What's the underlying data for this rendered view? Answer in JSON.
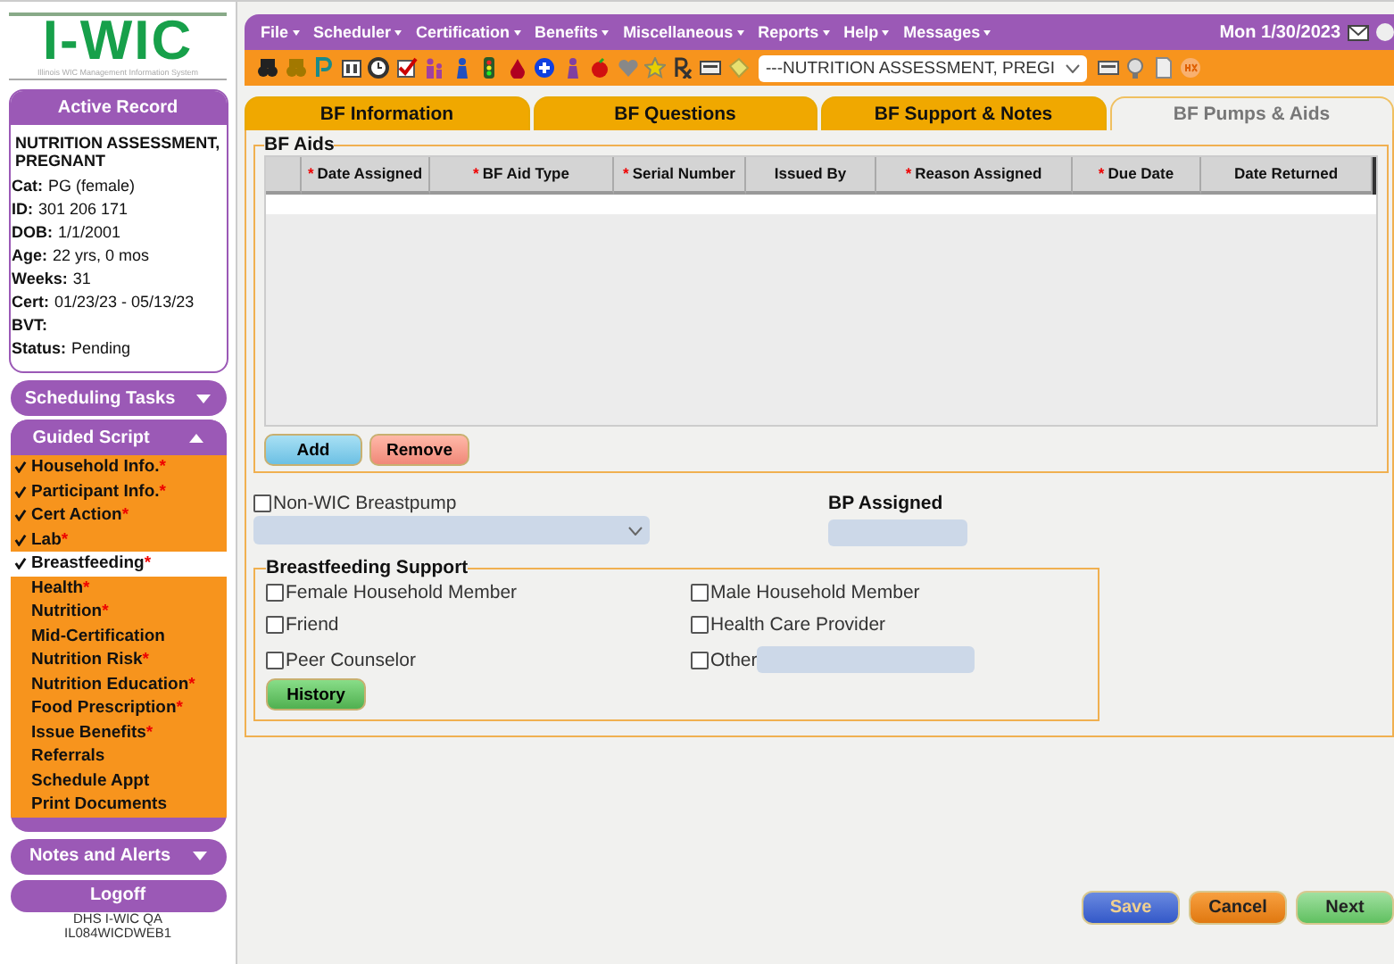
{
  "logo": {
    "title": "I-WIC",
    "subtitle": "Illinois WIC Management Information System"
  },
  "menu": [
    {
      "label": "File"
    },
    {
      "label": "Scheduler"
    },
    {
      "label": "Certification"
    },
    {
      "label": "Benefits"
    },
    {
      "label": "Miscellaneous"
    },
    {
      "label": "Reports"
    },
    {
      "label": "Help"
    },
    {
      "label": "Messages"
    }
  ],
  "date": "Mon 1/30/2023",
  "toolbar": {
    "record_select": "---NUTRITION ASSESSMENT, PREGI"
  },
  "active_record": {
    "title": "Active Record",
    "name": "NUTRITION ASSESSMENT, PREGNANT",
    "fields": [
      {
        "label": "Cat:",
        "value": "PG (female)"
      },
      {
        "label": "ID:",
        "value": "301 206 171"
      },
      {
        "label": "DOB:",
        "value": "1/1/2001"
      },
      {
        "label": "Age:",
        "value": "22 yrs, 0 mos"
      },
      {
        "label": "Weeks:",
        "value": "31"
      },
      {
        "label": "Cert:",
        "value": "01/23/23 - 05/13/23"
      },
      {
        "label": "BVT:"
      },
      {
        "label": "Status:",
        "value": "Pending"
      }
    ]
  },
  "scheduling_tasks": {
    "label": "Scheduling Tasks",
    "expanded": false
  },
  "guided_script": {
    "label": "Guided Script",
    "expanded": true,
    "items": [
      {
        "label": "Household Info.",
        "mark": "*",
        "checked": true,
        "selected": false
      },
      {
        "label": "Participant Info.",
        "mark": "*",
        "checked": true,
        "selected": false
      },
      {
        "label": "Cert Action",
        "mark": "*",
        "checked": true,
        "selected": false
      },
      {
        "label": "Lab",
        "mark": "*",
        "checked": true,
        "selected": false
      },
      {
        "label": "Breastfeeding",
        "mark": "*",
        "checked": true,
        "selected": true
      },
      {
        "label": "Health",
        "mark": "*",
        "checked": false,
        "selected": false
      },
      {
        "label": "Nutrition",
        "mark": "*",
        "checked": false,
        "selected": false
      },
      {
        "label": "Mid-Certification",
        "checked": false,
        "selected": false
      },
      {
        "label": "Nutrition Risk",
        "mark": "*",
        "checked": false,
        "selected": false
      },
      {
        "label": "Nutrition Education",
        "mark": "*",
        "checked": false,
        "selected": false
      },
      {
        "label": "Food Prescription",
        "mark": "*",
        "checked": false,
        "selected": false
      },
      {
        "label": "Issue Benefits",
        "mark": "*",
        "checked": false,
        "selected": false
      },
      {
        "label": "Referrals",
        "checked": false,
        "selected": false
      },
      {
        "label": "Schedule Appt",
        "checked": false,
        "selected": false
      },
      {
        "label": "Print Documents",
        "checked": false,
        "selected": false
      }
    ]
  },
  "notes_and_alerts": {
    "label": "Notes and Alerts",
    "expanded": false
  },
  "logoff": "Logoff",
  "server": [
    "DHS I-WIC QA",
    "IL084WICDWEB1"
  ],
  "tabs": [
    {
      "label": "BF Information",
      "selected": false
    },
    {
      "label": "BF Questions",
      "selected": false
    },
    {
      "label": "BF Support & Notes",
      "selected": false
    },
    {
      "label": "BF Pumps & Aids",
      "selected": true
    }
  ],
  "bf_aids": {
    "legend": "BF Aids",
    "columns": [
      {
        "label": "Date Assigned",
        "mark": "*"
      },
      {
        "label": "BF Aid Type",
        "mark": "*"
      },
      {
        "label": "Serial Number",
        "mark": "*"
      },
      {
        "label": "Issued By"
      },
      {
        "label": "Reason Assigned",
        "mark": "*"
      },
      {
        "label": "Due Date",
        "mark": "*"
      },
      {
        "label": "Date Returned"
      }
    ],
    "buttons": [
      "Add",
      "Remove"
    ]
  },
  "non_wic_breastpump": {
    "label": "Non-WIC Breastpump",
    "checked": false
  },
  "bp_assigned": {
    "label": "BP Assigned"
  },
  "breastfeeding_support": {
    "legend": "Breastfeeding Support",
    "options": [
      {
        "label": "Female Household Member",
        "checked": false
      },
      {
        "label": "Male Household Member",
        "checked": false
      },
      {
        "label": "Friend",
        "checked": false
      },
      {
        "label": "Health Care Provider",
        "checked": false
      },
      {
        "label": "Peer Counselor",
        "checked": false
      },
      {
        "label": "Other",
        "checked": false,
        "kind": "with-field"
      }
    ],
    "history_button": "History"
  },
  "footer_buttons": [
    {
      "label": "Save",
      "kind": "save"
    },
    {
      "label": "Cancel",
      "kind": "cancel"
    },
    {
      "label": "Next",
      "kind": "next"
    }
  ]
}
